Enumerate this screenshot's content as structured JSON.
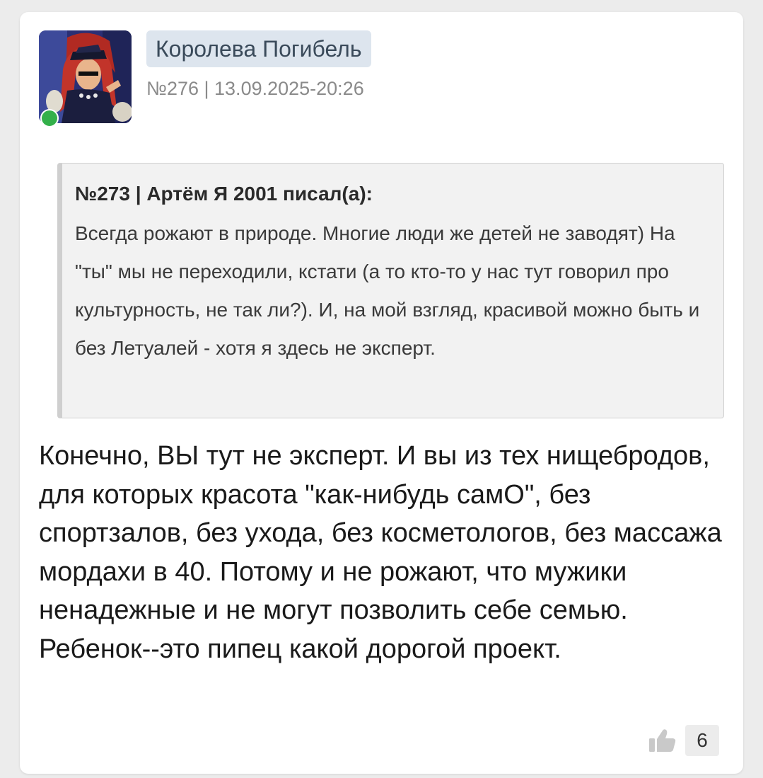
{
  "post": {
    "author": "Королева Погибель",
    "meta": "№276 | 13.09.2025-20:26",
    "quote": {
      "header": "№273 | Артём Я 2001 писал(а):",
      "text": "Всегда рожают в природе. Многие люди же детей не заводят) На \"ты\" мы не переходили, кстати (а то кто-то у нас тут говорил про культурность, не так ли?). И, на мой взгляд, красивой можно быть и без Летуалей - хотя я здесь не эксперт."
    },
    "text": "Конечно, ВЫ тут не эксперт. И вы из тех нищебродов, для которых красота \"как-нибудь самО\", без спортзалов, без ухода, без косметологов, без массажа мордахи в 40. Потому и не рожают, что мужики ненадежные и не могут позволить себе семью. Ребенок--это пипец какой дорогой проект.",
    "likes": "6",
    "online": true,
    "like_icon": "thumbs-up-icon",
    "colors": {
      "online": "#33b04a",
      "name_badge": "#dde5ee",
      "quote_bg": "#f2f2f2"
    }
  }
}
